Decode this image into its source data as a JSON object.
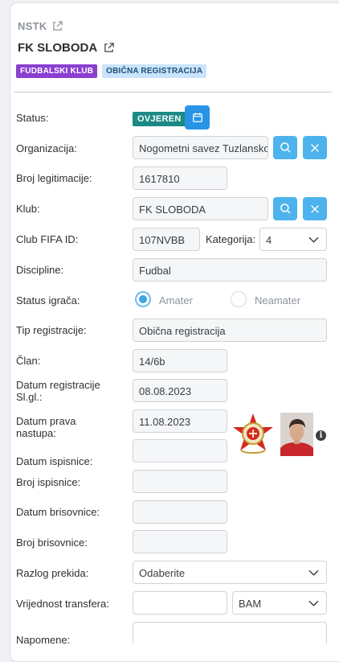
{
  "header": {
    "breadcrumb": "NSTK",
    "title": "FK SLOBODA",
    "badges": [
      "FUDBALSKI KLUB",
      "OBIČNA REGISTRACIJA"
    ]
  },
  "form": {
    "status": {
      "label": "Status:",
      "value": "OVJEREN"
    },
    "organizacija": {
      "label": "Organizacija:",
      "value": "Nogometni savez Tuzlanskog kantona"
    },
    "broj_legitimacije": {
      "label": "Broj legitimacije:",
      "value": "1617810"
    },
    "klub": {
      "label": "Klub:",
      "value": "FK SLOBODA"
    },
    "club_fifa_id": {
      "label": "Club FIFA ID:",
      "value": "107NVBB"
    },
    "kategorija": {
      "label": "Kategorija:",
      "value": "4"
    },
    "discipline": {
      "label": "Discipline:",
      "value": "Fudbal"
    },
    "status_igraca": {
      "label": "Status igrača:",
      "option_on": "Amater",
      "option_off": "Neamater"
    },
    "tip_registracije": {
      "label": "Tip registracije:",
      "value": "Obična registracija"
    },
    "clan": {
      "label": "Član:",
      "value": "14/6b"
    },
    "datum_registracije": {
      "label_line1": "Datum registracije",
      "label_line2": "Sl.gl.:",
      "value": "08.08.2023"
    },
    "datum_prava": {
      "label_line1": "Datum prava",
      "label_line2": "nastupa:",
      "value": "11.08.2023"
    },
    "datum_ispisnice": {
      "label": "Datum ispisnice:",
      "value": ""
    },
    "broj_ispisnice": {
      "label": "Broj ispisnice:",
      "value": ""
    },
    "datum_brisovnice": {
      "label": "Datum brisovnice:",
      "value": ""
    },
    "broj_brisovnice": {
      "label": "Broj brisovnice:",
      "value": ""
    },
    "razlog_prekida": {
      "label": "Razlog prekida:",
      "value": "Odaberite"
    },
    "vrijednost_transfera": {
      "label": "Vrijednost transfera:",
      "value": "",
      "currency": "BAM"
    },
    "napomene": {
      "label": "Napomene:",
      "value": ""
    }
  },
  "colors": {
    "accent": "#4db3ec",
    "status": "#1b8a84",
    "badge_purple": "#8a3fd0",
    "badge_blue": "#c9e4fb"
  },
  "icons": [
    "external-link-icon",
    "calendar-icon",
    "search-icon",
    "close-icon",
    "chevron-down-icon",
    "info-icon",
    "club-logo",
    "player-photo"
  ]
}
